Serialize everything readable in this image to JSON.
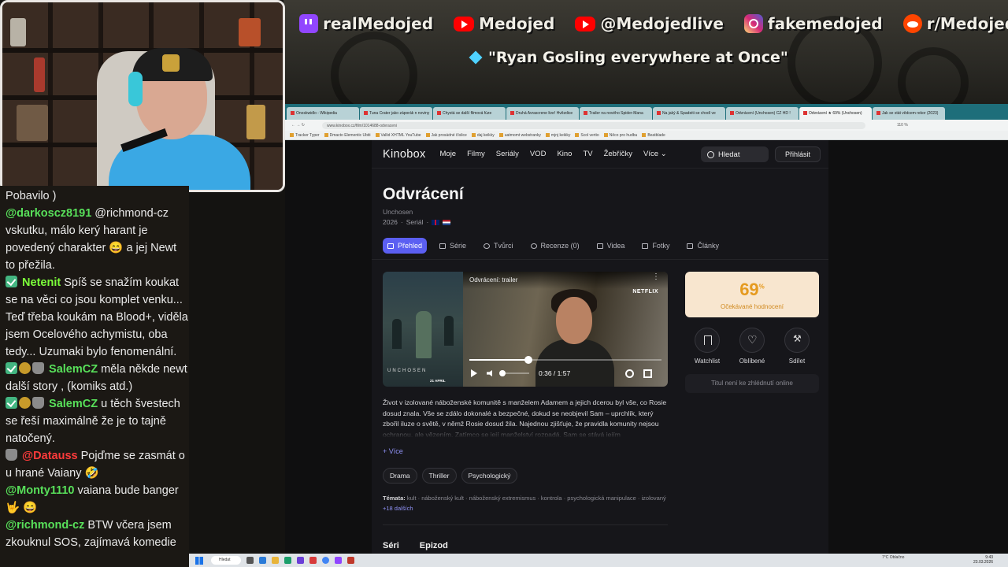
{
  "overlay": {
    "socials": [
      {
        "icon": "twitch-icon",
        "handle": "realMedojed"
      },
      {
        "icon": "youtube-icon",
        "handle": "Medojed"
      },
      {
        "icon": "youtube-icon",
        "handle": "@Medojedlive"
      },
      {
        "icon": "instagram-icon",
        "handle": "fakemedojed"
      },
      {
        "icon": "reddit-icon",
        "handle": "r/MedojedSubMissions"
      }
    ],
    "quote": "\"Ryan Gosling everywhere at Once\"",
    "colors": {
      "twitch": "#9146ff",
      "youtube": "#ff0000",
      "reddit": "#ff4500",
      "diamond": "#4fd2ff"
    }
  },
  "chat": {
    "messages": [
      {
        "user": "",
        "user_color": "#eaeaea",
        "badges": [],
        "text": "Pobavilo )"
      },
      {
        "user": "@darkoscz8191",
        "user_color": "#58e05a",
        "badges": [],
        "text": "@richmond-cz vskutku, málo kerý harant je povedený charakter 😄 a jej Newt to přežila."
      },
      {
        "user": "Netenit",
        "user_color": "#7cff3a",
        "badges": [
          "check"
        ],
        "text": "Spíš se snažím koukat se na věci co jsou komplet venku... Teď třeba koukám na Blood+, viděla jsem Ocelového achymistu, oba tedy... Uzumaki bylo fenomenální."
      },
      {
        "user": "SalemCZ",
        "user_color": "#58e05a",
        "badges": [
          "check",
          "coin",
          "mug"
        ],
        "text": "měla někde newt další story , (komiks atd.)"
      },
      {
        "user": "SalemCZ",
        "user_color": "#58e05a",
        "badges": [
          "check",
          "coin",
          "mug"
        ],
        "text": "u těch švestech se řeší maximálně že je to tajně natočený."
      },
      {
        "user": "@Datauss",
        "user_color": "#ff3b3b",
        "badges": [
          "mug"
        ],
        "text": "Pojďme se zasmát o u hrané Vaiany 🤣"
      },
      {
        "user": "@Monty1110",
        "user_color": "#58e05a",
        "badges": [],
        "text": "vaiana bude banger 🤟 😄"
      },
      {
        "user": "@richmond-cz",
        "user_color": "#58e05a",
        "badges": [],
        "text": "BTW včera jsem zkouknul SOS, zajímavá komedie"
      }
    ]
  },
  "browser": {
    "tabs": [
      "Onoskwidlo - Wikipedia",
      "Tuna Crater jako záporák n noviny",
      "Chystá se další filmová fúze",
      "Druhá Avrascrene live! Hvězdice",
      "Trailer na nového Spider-Mana",
      "Na jaký & Spadeiti se chodí ve",
      "Odvrácení (Unchosen) CZ HD !",
      "Odvrácení ★ 69% (Unchosen)",
      "Jak se stát vědcem rekor (2023)"
    ],
    "active_tab": 7,
    "url": "www.kinobox.cz/film/1014688-odvraceni",
    "zoom": "110 %",
    "bookmarks": [
      "Tracker Typer",
      "Dmacto Elementic Ubiti",
      "Vallid XHTML YouTube",
      "Jak prosádné číslice",
      "daj keikky",
      "uatmomt webstranky",
      "mjnj keikky",
      "Scol vertio",
      "Něco pro hudbu",
      "Beatblade"
    ]
  },
  "kinobox": {
    "logo": "Kinobox",
    "nav": [
      "Moje",
      "Filmy",
      "Seriály",
      "VOD",
      "Kino",
      "TV",
      "Žebříčky",
      "Více"
    ],
    "search_label": "Hledat",
    "login_label": "Přihlásit",
    "title": "Odvrácení",
    "original_title": "Unchosen",
    "year": "2026",
    "kind": "Seriál",
    "tabs": [
      {
        "label": "Přehled",
        "icon": "list-icon"
      },
      {
        "label": "Série",
        "icon": "folder-icon"
      },
      {
        "label": "Tvůrci",
        "icon": "people-icon"
      },
      {
        "label": "Recenze (0)",
        "icon": "comment-icon"
      },
      {
        "label": "Videa",
        "icon": "video-icon"
      },
      {
        "label": "Fotky",
        "icon": "photo-icon"
      },
      {
        "label": "Články",
        "icon": "article-icon"
      }
    ],
    "video": {
      "title": "Odvrácení: trailer",
      "brand": "NETFLIX",
      "current": "0:36",
      "duration": "1:57",
      "progress": 0.307,
      "poster_title": "UNCHOSEN",
      "poster_date": "21 APRIL"
    },
    "description": "Život v izolované náboženské komunitě s manželem Adamem a jejich dcerou byl vše, co Rosie dosud znala. Vše se zdálo dokonalé a bezpečné, dokud se neobjevil Sam – uprchlík, který zbořil iluze o světě, v němž Rosie dosud žila. Najednou zjišťuje, že pravidla komunity nejsou ochranou, ale vězením. Zatímco se její manželství rozpadá, Sam se stává jejím",
    "more_label": "+ Více",
    "genres": [
      "Drama",
      "Thriller",
      "Psychologický"
    ],
    "themes_label": "Témata:",
    "themes": "kult · náboženský kult · náboženský extremismus · kontrola · psychologická manipulace · izolovaný",
    "themes_more": "+18 dalších",
    "sections": [
      "Séri",
      "Epizod"
    ],
    "rating": {
      "score": "69",
      "unit": "%",
      "label": "Očekávané hodnocení",
      "color": "#e59a1f",
      "bg": "#f8e6cf"
    },
    "actions": [
      {
        "label": "Watchlist",
        "icon": "bookmark-icon"
      },
      {
        "label": "Oblíbené",
        "icon": "heart-icon"
      },
      {
        "label": "Sdílet",
        "icon": "share-icon"
      }
    ],
    "unavailable": "Titul není ke zhlédnutí online",
    "accent": "#5b5ff2"
  },
  "taskbar": {
    "search": "Hledat",
    "weather": "7°C Oblačno",
    "time": "9:43",
    "date": "23.03.2026"
  }
}
